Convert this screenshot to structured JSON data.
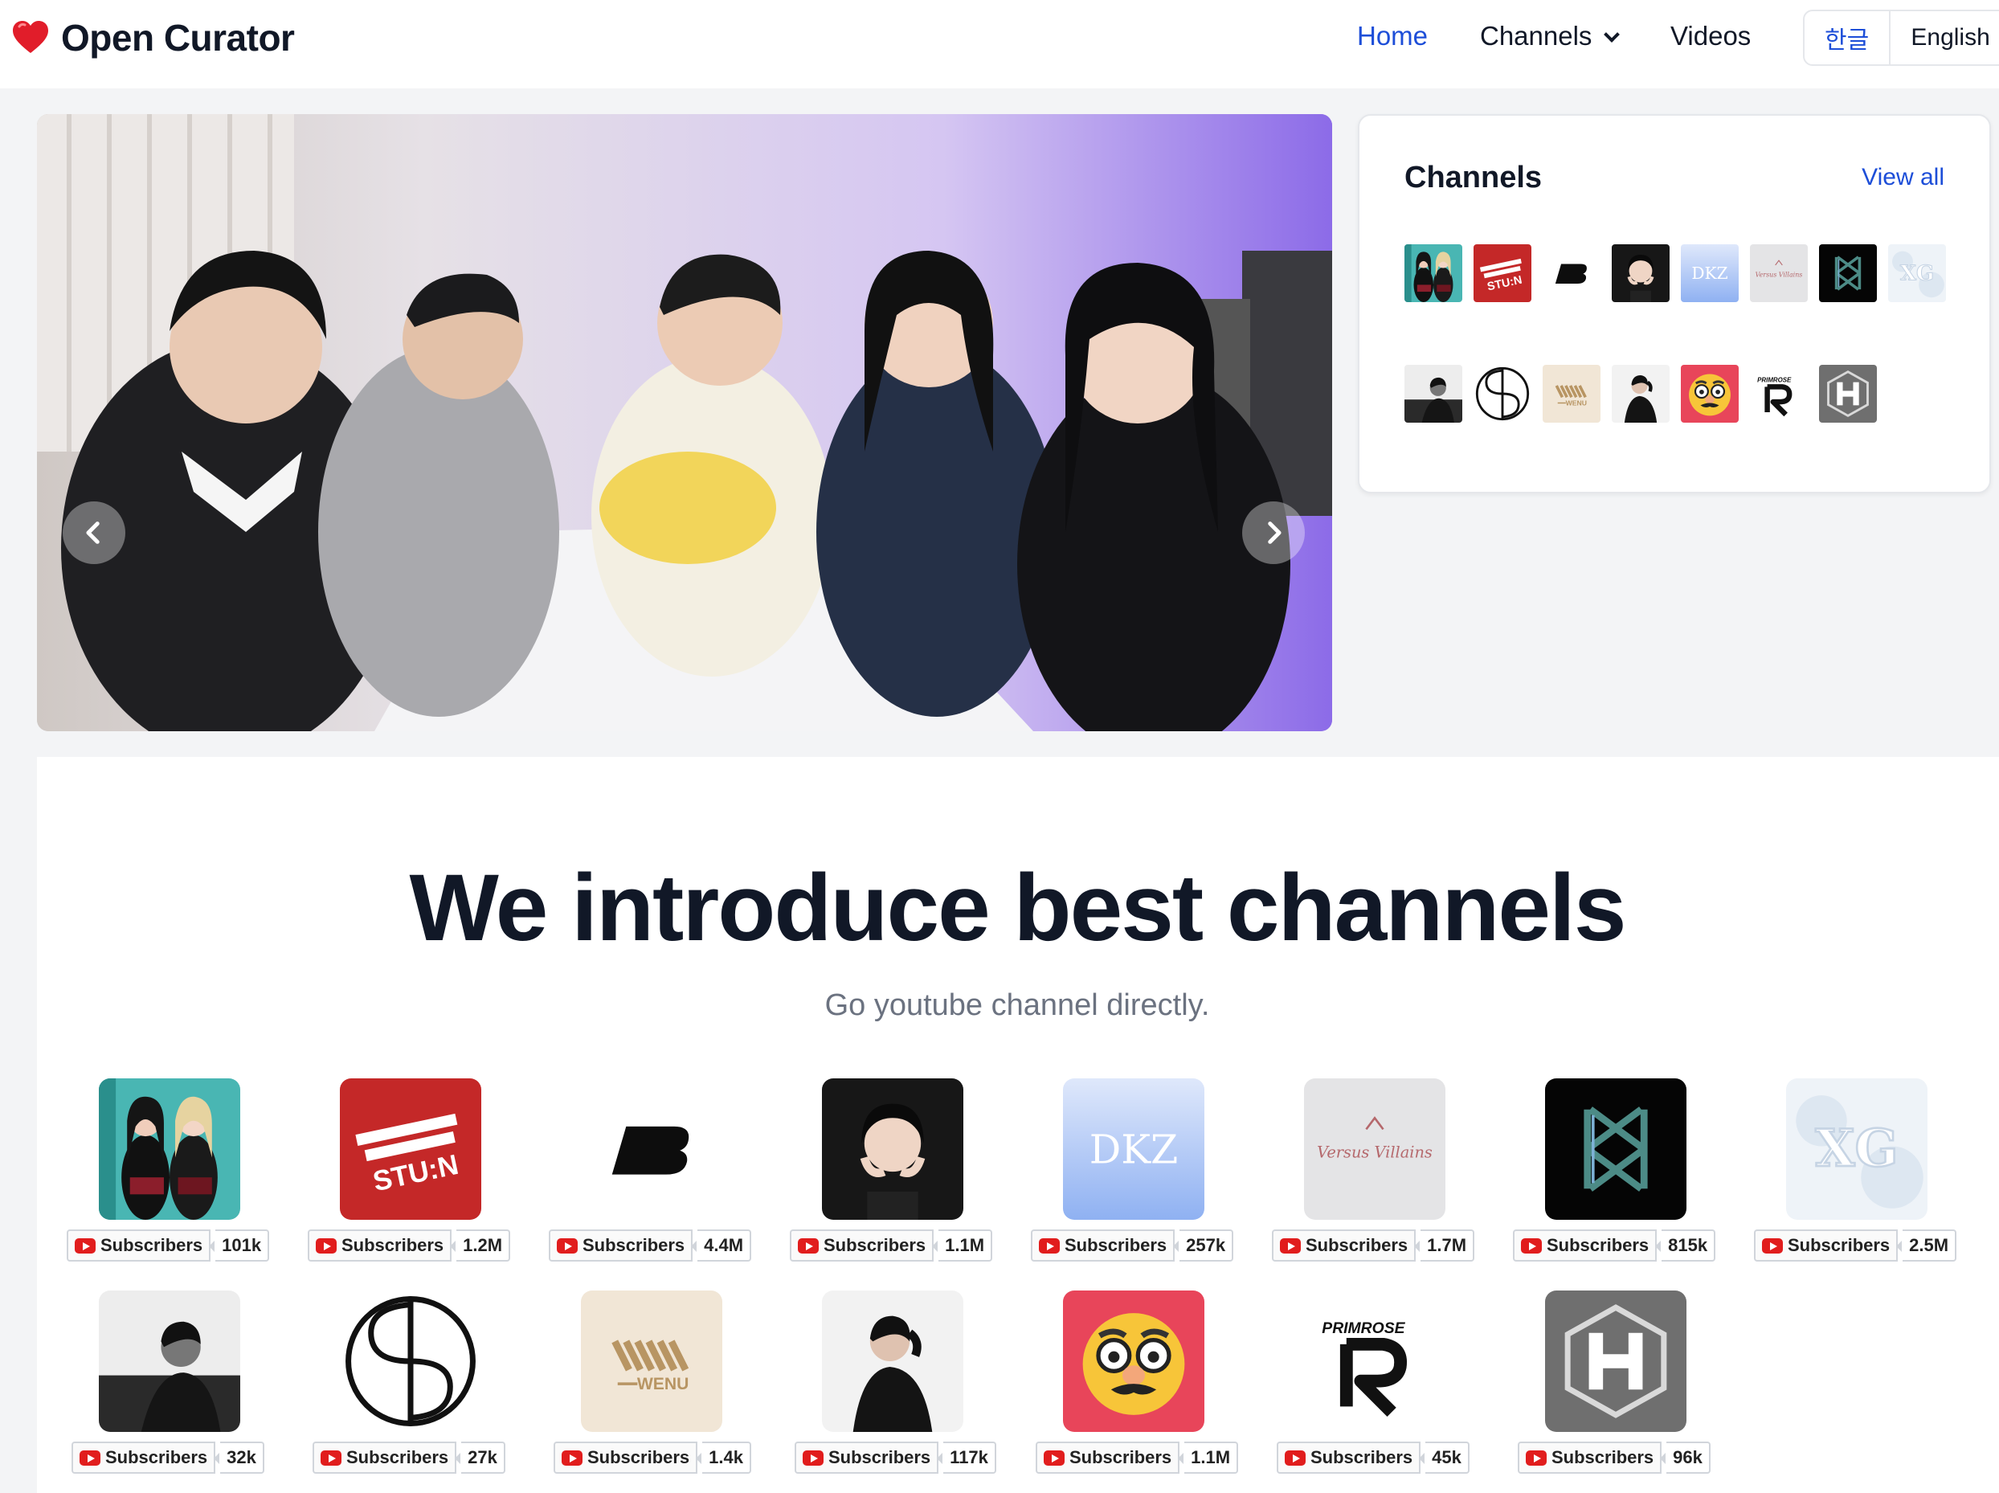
{
  "brand": {
    "name": "Open Curator"
  },
  "nav": {
    "home": "Home",
    "channels": "Channels",
    "videos": "Videos"
  },
  "lang": {
    "ko": "한글",
    "en": "English"
  },
  "colors": {
    "accent": "#1d4ed8",
    "youtube": "#e11d1d"
  },
  "sidebar_card": {
    "title": "Channels",
    "view_all": "View all"
  },
  "main": {
    "title": "We introduce best channels",
    "subtitle": "Go youtube channel directly."
  },
  "badge_label": "Subscribers",
  "channels": [
    {
      "logo": "girl-group-photo",
      "subscribers": "101k"
    },
    {
      "logo": "red-stuin-logo",
      "subscribers": "1.2M"
    },
    {
      "logo": "black-b-logo",
      "subscribers": "4.4M"
    },
    {
      "logo": "woman-portrait",
      "subscribers": "1.1M"
    },
    {
      "logo": "dkz-logo",
      "subscribers": "257k",
      "text": "DKZ"
    },
    {
      "logo": "versus-villains-logo",
      "subscribers": "1.7M",
      "text": "Versus Villains"
    },
    {
      "logo": "dark-k-logo",
      "subscribers": "815k"
    },
    {
      "logo": "xg-ice-logo",
      "subscribers": "2.5M",
      "text": "XG"
    },
    {
      "logo": "bw-portrait",
      "subscribers": "32k"
    },
    {
      "logo": "circle-symbol-logo",
      "subscribers": "27k"
    },
    {
      "logo": "wenu-logo",
      "subscribers": "1.4k",
      "text": "WENU"
    },
    {
      "logo": "man-profile-portrait",
      "subscribers": "117k"
    },
    {
      "logo": "disguise-emoji",
      "subscribers": "1.1M"
    },
    {
      "logo": "primrose-r-logo",
      "subscribers": "45k",
      "text": "PRIMROSE"
    },
    {
      "logo": "hexagon-h-logo",
      "subscribers": "96k"
    }
  ]
}
